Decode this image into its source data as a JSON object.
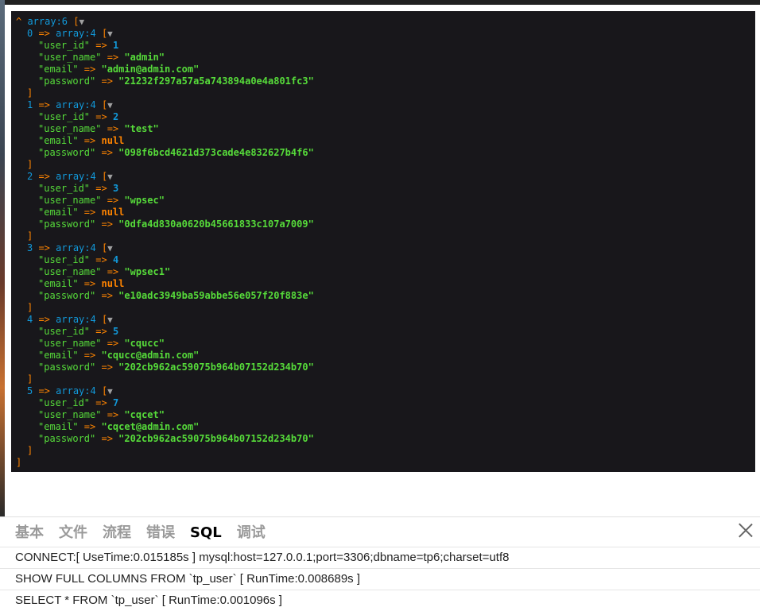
{
  "dump": {
    "root_note": "array:6",
    "items": [
      {
        "index": "0",
        "note": "array:4",
        "user_id": "1",
        "user_name": "\"admin\"",
        "email": "\"admin@admin.com\"",
        "email_null": false,
        "password": "\"21232f297a57a5a743894a0e4a801fc3\""
      },
      {
        "index": "1",
        "note": "array:4",
        "user_id": "2",
        "user_name": "\"test\"",
        "email": "null",
        "email_null": true,
        "password": "\"098f6bcd4621d373cade4e832627b4f6\""
      },
      {
        "index": "2",
        "note": "array:4",
        "user_id": "3",
        "user_name": "\"wpsec\"",
        "email": "null",
        "email_null": true,
        "password": "\"0dfa4d830a0620b45661833c107a7009\""
      },
      {
        "index": "3",
        "note": "array:4",
        "user_id": "4",
        "user_name": "\"wpsec1\"",
        "email": "null",
        "email_null": true,
        "password": "\"e10adc3949ba59abbe56e057f20f883e\""
      },
      {
        "index": "4",
        "note": "array:4",
        "user_id": "5",
        "user_name": "\"cqucc\"",
        "email": "\"cqucc@admin.com\"",
        "email_null": false,
        "password": "\"202cb962ac59075b964b07152d234b70\""
      },
      {
        "index": "5",
        "note": "array:4",
        "user_id": "7",
        "user_name": "\"cqcet\"",
        "email": "\"cqcet@admin.com\"",
        "email_null": false,
        "password": "\"202cb962ac59075b964b07152d234b70\""
      }
    ],
    "keys": {
      "user_id": "\"user_id\"",
      "user_name": "\"user_name\"",
      "email": "\"email\"",
      "password": "\"password\""
    }
  },
  "debug": {
    "tabs": [
      {
        "label": "基本",
        "active": false
      },
      {
        "label": "文件",
        "active": false
      },
      {
        "label": "流程",
        "active": false
      },
      {
        "label": "错误",
        "active": false
      },
      {
        "label": "SQL",
        "active": true
      },
      {
        "label": "调试",
        "active": false
      }
    ],
    "sql_rows": [
      "CONNECT:[ UseTime:0.015185s ] mysql:host=127.0.0.1;port=3306;dbname=tp6;charset=utf8",
      "SHOW FULL COLUMNS FROM `tp_user` [ RunTime:0.008689s ]",
      "SELECT * FROM `tp_user` [ RunTime:0.001096s ]"
    ]
  },
  "colors": {
    "dump_bg": "#18171b",
    "key": "#56db3a",
    "number": "#1299da",
    "punct": "#ff8400"
  }
}
